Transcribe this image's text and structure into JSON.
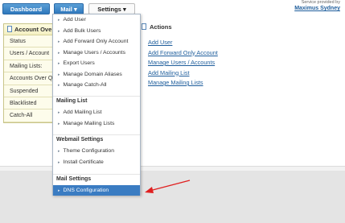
{
  "nav": {
    "dashboard": "Dashboard",
    "mail": "Mail",
    "settings": "Settings",
    "caret": "▾"
  },
  "service": {
    "provided_by": "Service provided by",
    "name": "Maximus Sydney"
  },
  "account_overview": {
    "title": "Account Ove",
    "rows": [
      "Status",
      "Users / Account",
      "Mailing Lists:",
      "Accounts Over Q",
      "Suspended",
      "Blacklisted",
      "Catch-All"
    ]
  },
  "actions": {
    "title": "Actions",
    "links": [
      "Add User",
      "Add Forward Only Account",
      "Manage Users / Accounts",
      "Add Mailing List",
      "Manage Mailing Lists"
    ]
  },
  "mail_menu": {
    "items": [
      "Add User",
      "Add Bulk Users",
      "Add Forward Only Account",
      "Manage Users / Accounts",
      "Export Users",
      "Manage Domain Aliases",
      "Manage Catch-All"
    ],
    "sections": [
      {
        "header": "Mailing List",
        "items": [
          "Add Mailing List",
          "Manage Mailing Lists"
        ]
      },
      {
        "header": "Webmail Settings",
        "items": [
          "Theme Configuration",
          "Install Certificate"
        ]
      },
      {
        "header": "Mail Settings",
        "items": [
          "DNS Configuration"
        ]
      }
    ],
    "active_item": "DNS Configuration",
    "bullet": "▸"
  },
  "colors": {
    "accent": "#3a7cc2",
    "annotation": "#e02020"
  }
}
